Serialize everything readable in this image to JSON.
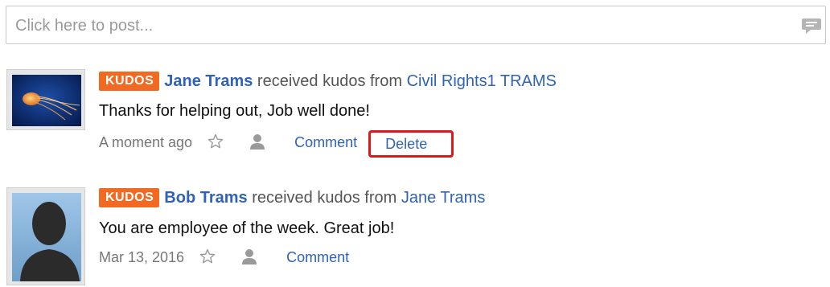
{
  "composer": {
    "placeholder": "Click here to post..."
  },
  "feed": [
    {
      "badge": "KUDOS",
      "actor": "Jane Trams",
      "verb": "received kudos from",
      "target": "Civil Rights1 TRAMS",
      "message": "Thanks for helping out, Job well done!",
      "time": "A moment ago",
      "comment_label": "Comment",
      "delete_label": "Delete",
      "avatar": "jellyfish-photo"
    },
    {
      "badge": "KUDOS",
      "actor": "Bob Trams",
      "verb": "received kudos from",
      "target": "Jane Trams",
      "message": "You are employee of the week. Great job!",
      "time": "Mar 13, 2016",
      "comment_label": "Comment",
      "avatar": "silhouette-placeholder"
    }
  ],
  "colors": {
    "badge": "#f26a21",
    "link": "#2f62b8",
    "highlight": "#e0161d"
  }
}
